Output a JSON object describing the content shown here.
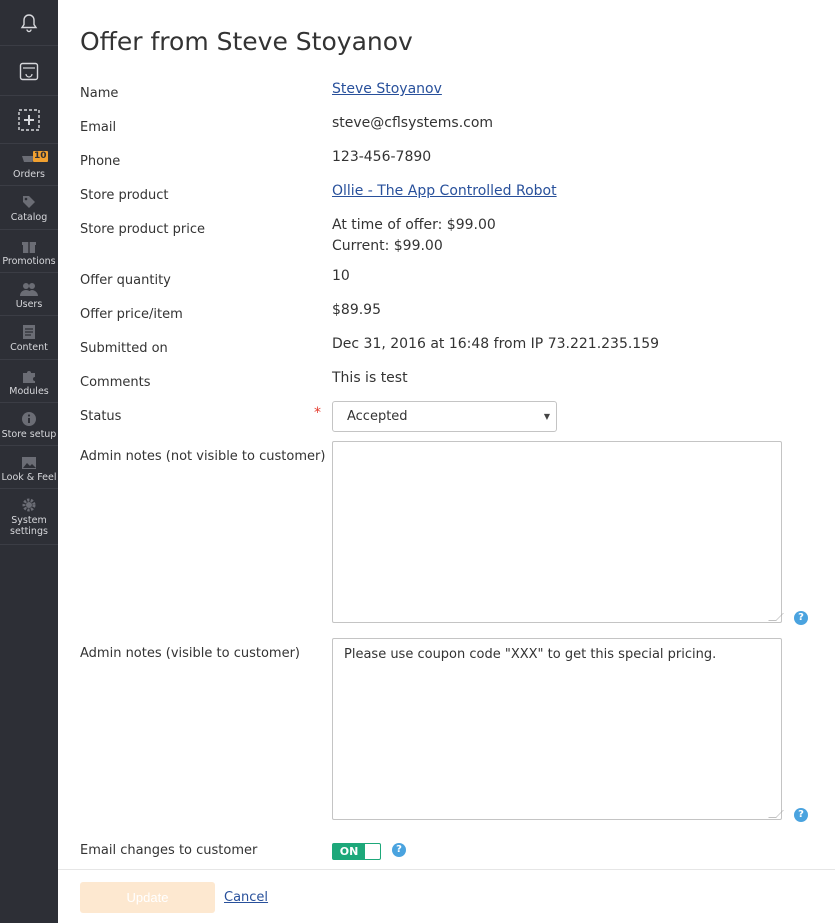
{
  "colors": {
    "sidebar_bg": "#2d2f36",
    "link": "#28509b",
    "toggle_on": "#1da87a",
    "update_button": "#fde8d0",
    "required": "#e53a2c",
    "help": "#4aa3df",
    "badge": "#f0a030"
  },
  "sidebar": {
    "top_icons": [
      "bell-icon",
      "calendar-icon",
      "add-icon"
    ],
    "items": [
      {
        "label": "Orders",
        "icon": "orders-icon",
        "badge": "10"
      },
      {
        "label": "Catalog",
        "icon": "tag-icon"
      },
      {
        "label": "Promotions",
        "icon": "gift-icon"
      },
      {
        "label": "Users",
        "icon": "users-icon"
      },
      {
        "label": "Content",
        "icon": "content-icon"
      },
      {
        "label": "Modules",
        "icon": "puzzle-icon"
      },
      {
        "label": "Store setup",
        "icon": "info-icon"
      },
      {
        "label": "Look & Feel",
        "icon": "image-icon"
      },
      {
        "label": "System settings",
        "icon": "gear-icon"
      }
    ]
  },
  "page": {
    "title": "Offer from Steve Stoyanov"
  },
  "fields": {
    "name": {
      "label": "Name",
      "value": "Steve Stoyanov"
    },
    "email": {
      "label": "Email",
      "value": "steve@cflsystems.com"
    },
    "phone": {
      "label": "Phone",
      "value": "123-456-7890"
    },
    "store_product": {
      "label": "Store product",
      "value": "Ollie - The App Controlled Robot"
    },
    "store_product_price": {
      "label": "Store product price",
      "value_offer": "At time of offer: $99.00",
      "value_current": "Current: $99.00"
    },
    "offer_quantity": {
      "label": "Offer quantity",
      "value": "10"
    },
    "offer_price": {
      "label": "Offer price/item",
      "value": "$89.95"
    },
    "submitted_on": {
      "label": "Submitted on",
      "value": "Dec 31, 2016 at 16:48 from IP 73.221.235.159"
    },
    "comments": {
      "label": "Comments",
      "value": "This is test"
    },
    "status": {
      "label": "Status",
      "required": "*",
      "value": "Accepted"
    },
    "admin_notes_private": {
      "label": "Admin notes (not visible to customer)",
      "value": ""
    },
    "admin_notes_public": {
      "label": "Admin notes (visible to customer)",
      "value": "Please use coupon code \"XXX\" to get this special pricing."
    },
    "email_changes": {
      "label": "Email changes to customer",
      "toggle": "ON"
    }
  },
  "footer": {
    "update_label": "Update",
    "cancel_label": "Cancel"
  },
  "help_glyph": "?"
}
